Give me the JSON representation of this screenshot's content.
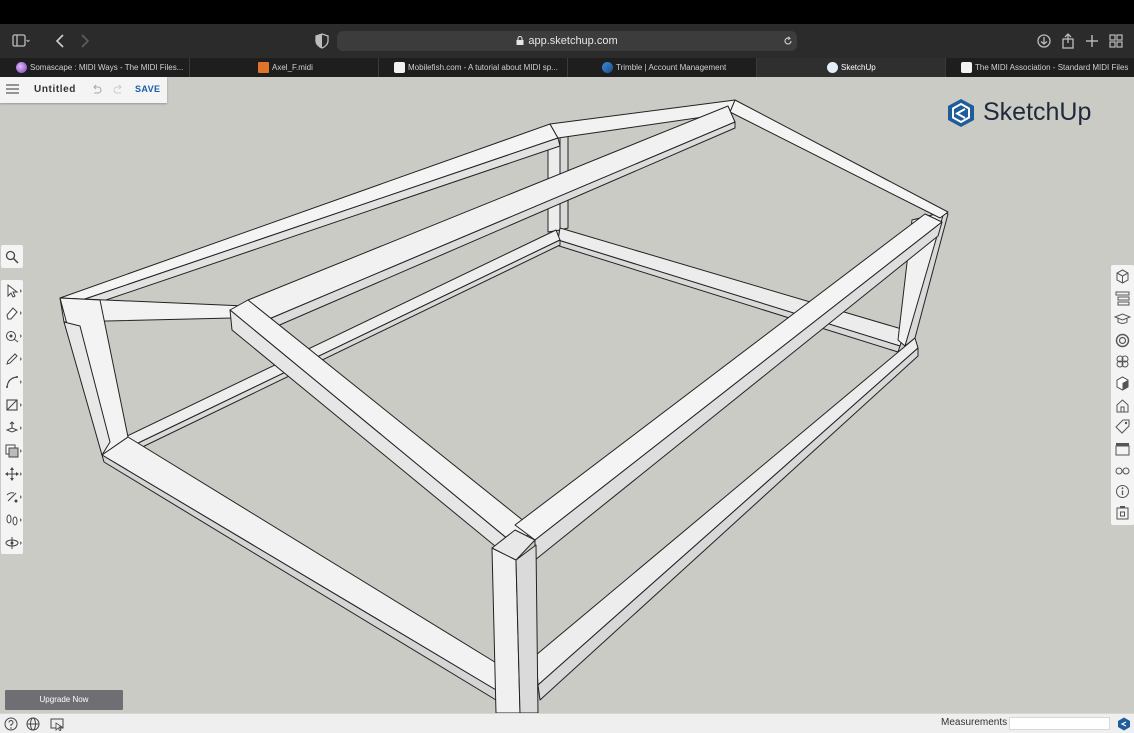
{
  "browser": {
    "url": "app.sketchup.com",
    "tabs": [
      {
        "title": "Somascape : MIDI Ways - The MIDI Files...",
        "favicon": "purple-orb-icon",
        "active": false
      },
      {
        "title": "Axel_F.midi",
        "favicon": "html-file-icon",
        "active": false
      },
      {
        "title": "Mobilefish.com - A tutorial about MIDI sp...",
        "favicon": "play-icon",
        "active": false
      },
      {
        "title": "Trimble | Account Management",
        "favicon": "trimble-icon",
        "active": false
      },
      {
        "title": "SketchUp",
        "favicon": "sketchup-icon",
        "active": true
      },
      {
        "title": "The MIDI Association - Standard MIDI Files",
        "favicon": "tma-icon",
        "active": false
      }
    ]
  },
  "document": {
    "title": "Untitled",
    "save_label": "SAVE"
  },
  "brand": {
    "name": "SketchUp",
    "color": "#1f5c9a"
  },
  "left_tools": [
    {
      "name": "select-tool"
    },
    {
      "name": "eraser-tool"
    },
    {
      "name": "tape-measure-tool"
    },
    {
      "name": "pencil-line-tool"
    },
    {
      "name": "arc-tool"
    },
    {
      "name": "rectangle-tool"
    },
    {
      "name": "push-pull-tool"
    },
    {
      "name": "offset-tool"
    },
    {
      "name": "move-tool"
    },
    {
      "name": "rotate-tool"
    },
    {
      "name": "walk-tool"
    },
    {
      "name": "orbit-tool"
    }
  ],
  "right_panels": [
    {
      "name": "entity-info-panel"
    },
    {
      "name": "outliner-panel"
    },
    {
      "name": "instructor-panel"
    },
    {
      "name": "materials-panel"
    },
    {
      "name": "components-panel"
    },
    {
      "name": "styles-panel"
    },
    {
      "name": "scenes-panel"
    },
    {
      "name": "tags-panel"
    },
    {
      "name": "animation-panel"
    },
    {
      "name": "display-panel"
    },
    {
      "name": "info-panel"
    },
    {
      "name": "3d-warehouse-panel"
    }
  ],
  "footer": {
    "upgrade_label": "Upgrade Now",
    "measurements_label": "Measurements",
    "measurements_value": ""
  },
  "colors": {
    "viewport_bg": "#cbcbc6",
    "face_light": "#f5f5f5",
    "face_mid": "#e6e6e6",
    "face_dark": "#d4d4d4",
    "edge": "#222222",
    "save_link": "#1a5ea8"
  }
}
